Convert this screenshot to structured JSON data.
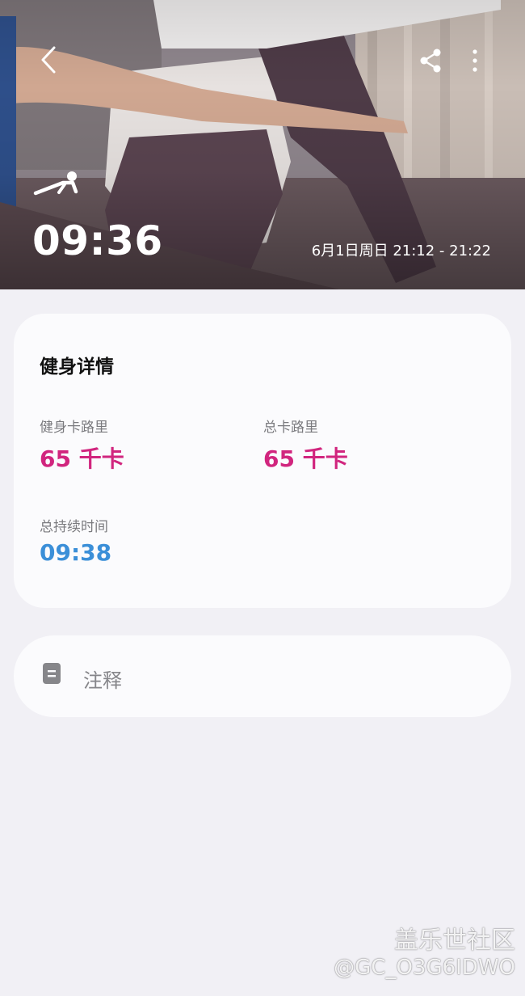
{
  "header": {
    "back_icon": "chevron-left-icon",
    "share_icon": "share-icon",
    "more_icon": "more-vertical-icon",
    "workout_icon": "plank-icon",
    "duration": "09:36",
    "time_range": "6月1日周日 21:12 - 21:22"
  },
  "details": {
    "title": "健身详情",
    "workout_calories_label": "健身卡路里",
    "workout_calories_value": "65 千卡",
    "total_calories_label": "总卡路里",
    "total_calories_value": "65 千卡",
    "total_duration_label": "总持续时间",
    "total_duration_value": "09:38"
  },
  "notes": {
    "icon": "note-icon",
    "label": "注释"
  },
  "colors": {
    "calorie": "#d1257e",
    "duration": "#3b8fd8",
    "background": "#f1f0f5",
    "card": "#fbfbfd"
  },
  "watermark": {
    "line1": "盖乐世社区",
    "line2": "@GC_O3G6IDWO"
  }
}
